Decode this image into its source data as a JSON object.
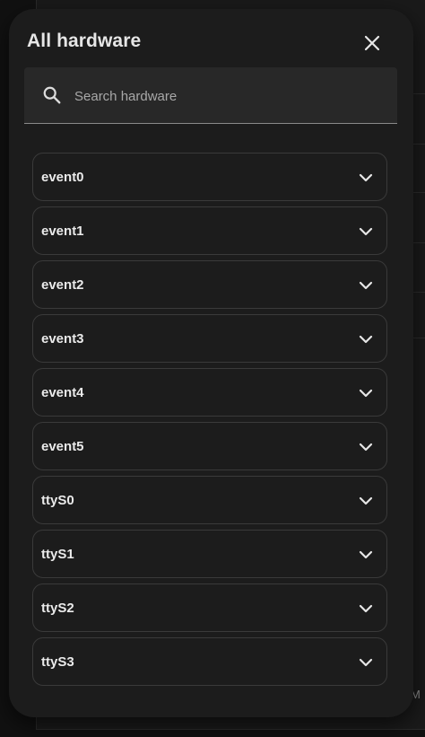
{
  "dialog": {
    "title": "All hardware",
    "close_icon": "close-icon"
  },
  "search": {
    "placeholder": "Search hardware",
    "value": "",
    "icon": "search-icon"
  },
  "hardware_list": {
    "items": [
      {
        "label": "event0"
      },
      {
        "label": "event1"
      },
      {
        "label": "event2"
      },
      {
        "label": "event3"
      },
      {
        "label": "event4"
      },
      {
        "label": "event5"
      },
      {
        "label": "ttyS0"
      },
      {
        "label": "ttyS1"
      },
      {
        "label": "ttyS2"
      },
      {
        "label": "ttyS3"
      }
    ],
    "expand_icon": "chevron-down-icon"
  },
  "background": {
    "partial_text": "M"
  },
  "colors": {
    "dialog_bg": "#1c1c1c",
    "field_bg": "#282828",
    "text_primary": "#eaeaea",
    "text_secondary": "#a8a8a8",
    "item_border": "#3a3a3a"
  }
}
